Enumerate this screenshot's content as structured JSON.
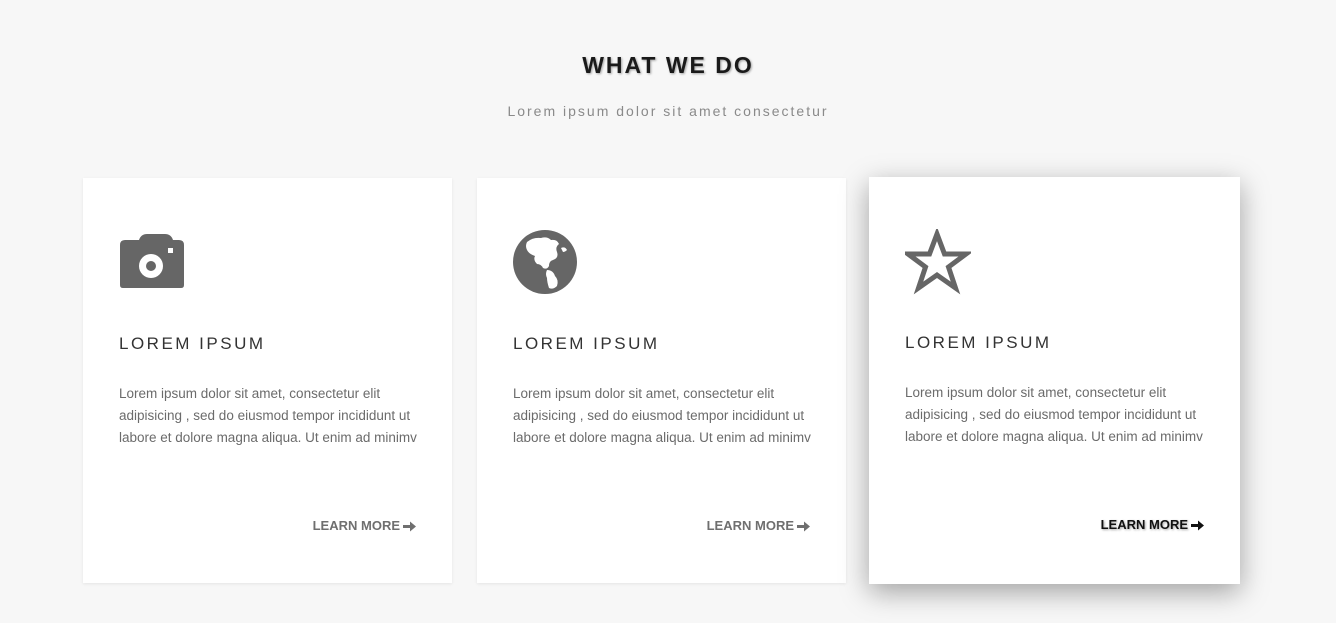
{
  "section": {
    "title": "WHAT WE DO",
    "subtitle": "Lorem ipsum dolor sit amet consectetur"
  },
  "cards": [
    {
      "icon": "camera-icon",
      "title": "LOREM IPSUM",
      "text": "Lorem ipsum dolor sit amet, consectetur elit adipisicing , sed do eiusmod tempor incididunt ut labore et dolore magna aliqua. Ut enim ad minimv",
      "link_label": "LEARN MORE"
    },
    {
      "icon": "globe-icon",
      "title": "LOREM IPSUM",
      "text": "Lorem ipsum dolor sit amet, consectetur elit adipisicing , sed do eiusmod tempor incididunt ut labore et dolore magna aliqua. Ut enim ad minimv",
      "link_label": "LEARN MORE"
    },
    {
      "icon": "star-icon",
      "title": "LOREM IPSUM",
      "text": "Lorem ipsum dolor sit amet, consectetur elit adipisicing , sed do eiusmod tempor incididunt ut labore et dolore magna aliqua. Ut enim ad minimv",
      "link_label": "LEARN MORE"
    }
  ],
  "colors": {
    "background": "#f7f7f7",
    "card": "#ffffff",
    "icon": "#666666",
    "heading": "#1a1a1a",
    "body_text": "#6b6b6b"
  }
}
